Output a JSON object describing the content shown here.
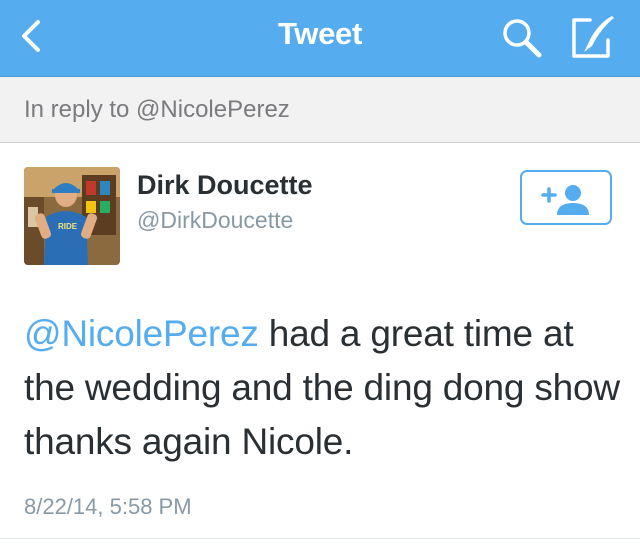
{
  "nav": {
    "title": "Tweet",
    "back_icon": "chevron-left-icon",
    "search_icon": "search-icon",
    "compose_icon": "compose-icon"
  },
  "reply": {
    "label": "In reply to @NicolePerez"
  },
  "author": {
    "name": "Dirk Doucette",
    "handle": "@DirkDoucette"
  },
  "tweet": {
    "mention": "@NicolePerez",
    "body": " had a great time at the wedding and the ding dong show thanks again Nicole.",
    "timestamp": "8/22/14, 5:58 PM"
  },
  "colors": {
    "brand": "#55acee",
    "text": "#292f33",
    "muted": "#8899a6"
  }
}
